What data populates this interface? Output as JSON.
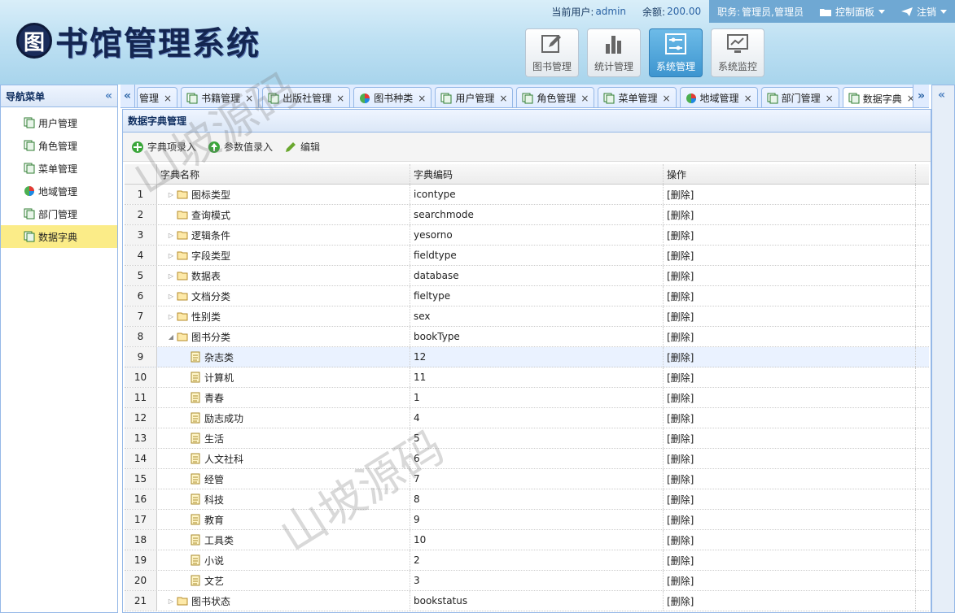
{
  "header": {
    "logo_mark": "图",
    "logo_text": "书馆管理系统",
    "current_user_label": "当前用户:",
    "current_user": "admin",
    "balance_label": "余额:",
    "balance": "200.00",
    "role_label": "职务:",
    "role": "管理员,管理员",
    "control_panel": "控制面板",
    "logout": "注销"
  },
  "modules": [
    {
      "label": "图书管理",
      "icon": "edit-icon",
      "active": false
    },
    {
      "label": "统计管理",
      "icon": "bar-chart-icon",
      "active": false
    },
    {
      "label": "系统管理",
      "icon": "settings-sliders-icon",
      "active": true
    },
    {
      "label": "系统监控",
      "icon": "monitor-icon",
      "active": false
    }
  ],
  "nav": {
    "title": "导航菜单",
    "items": [
      {
        "label": "用户管理",
        "icon": "page-icon"
      },
      {
        "label": "角色管理",
        "icon": "page-icon"
      },
      {
        "label": "菜单管理",
        "icon": "page-icon"
      },
      {
        "label": "地域管理",
        "icon": "globe-icon"
      },
      {
        "label": "部门管理",
        "icon": "page-icon"
      },
      {
        "label": "数据字典",
        "icon": "page-icon",
        "selected": true
      }
    ]
  },
  "tabs": [
    {
      "label": "管理",
      "icon": "",
      "active": false
    },
    {
      "label": "书籍管理",
      "icon": "page-icon",
      "active": false
    },
    {
      "label": "出版社管理",
      "icon": "page-icon",
      "active": false
    },
    {
      "label": "图书种类",
      "icon": "globe-icon",
      "active": false
    },
    {
      "label": "用户管理",
      "icon": "page-icon",
      "active": false
    },
    {
      "label": "角色管理",
      "icon": "page-icon",
      "active": false
    },
    {
      "label": "菜单管理",
      "icon": "page-icon",
      "active": false
    },
    {
      "label": "地域管理",
      "icon": "globe-icon",
      "active": false
    },
    {
      "label": "部门管理",
      "icon": "page-icon",
      "active": false
    },
    {
      "label": "数据字典",
      "icon": "page-icon",
      "active": true
    }
  ],
  "main": {
    "title": "数据字典管理",
    "toolbar": {
      "add_item": "字典项录入",
      "add_param": "参数值录入",
      "edit": "编辑"
    },
    "columns": {
      "name": "字典名称",
      "code": "字典编码",
      "op": "操作"
    },
    "rows": [
      {
        "num": "1",
        "name": "图标类型",
        "code": "icontype",
        "op": "[删除]",
        "level": 0,
        "expander": "collapsed"
      },
      {
        "num": "2",
        "name": "查询模式",
        "code": "searchmode",
        "op": "[删除]",
        "level": 0,
        "expander": "none"
      },
      {
        "num": "3",
        "name": "逻辑条件",
        "code": "yesorno",
        "op": "[删除]",
        "level": 0,
        "expander": "collapsed"
      },
      {
        "num": "4",
        "name": "字段类型",
        "code": "fieldtype",
        "op": "[删除]",
        "level": 0,
        "expander": "collapsed"
      },
      {
        "num": "5",
        "name": "数据表",
        "code": "database",
        "op": "[删除]",
        "level": 0,
        "expander": "collapsed"
      },
      {
        "num": "6",
        "name": "文档分类",
        "code": "fieltype",
        "op": "[删除]",
        "level": 0,
        "expander": "collapsed"
      },
      {
        "num": "7",
        "name": "性别类",
        "code": "sex",
        "op": "[删除]",
        "level": 0,
        "expander": "collapsed"
      },
      {
        "num": "8",
        "name": "图书分类",
        "code": "bookType",
        "op": "[删除]",
        "level": 0,
        "expander": "expanded"
      },
      {
        "num": "9",
        "name": "杂志类",
        "code": "12",
        "op": "[删除]",
        "level": 1,
        "highlight": true
      },
      {
        "num": "10",
        "name": "计算机",
        "code": "11",
        "op": "[删除]",
        "level": 1
      },
      {
        "num": "11",
        "name": "青春",
        "code": "1",
        "op": "[删除]",
        "level": 1
      },
      {
        "num": "12",
        "name": "励志成功",
        "code": "4",
        "op": "[删除]",
        "level": 1
      },
      {
        "num": "13",
        "name": "生活",
        "code": "5",
        "op": "[删除]",
        "level": 1
      },
      {
        "num": "14",
        "name": "人文社科",
        "code": "6",
        "op": "[删除]",
        "level": 1
      },
      {
        "num": "15",
        "name": "经管",
        "code": "7",
        "op": "[删除]",
        "level": 1
      },
      {
        "num": "16",
        "name": "科技",
        "code": "8",
        "op": "[删除]",
        "level": 1
      },
      {
        "num": "17",
        "name": "教育",
        "code": "9",
        "op": "[删除]",
        "level": 1
      },
      {
        "num": "18",
        "name": "工具类",
        "code": "10",
        "op": "[删除]",
        "level": 1
      },
      {
        "num": "19",
        "name": "小说",
        "code": "2",
        "op": "[删除]",
        "level": 1
      },
      {
        "num": "20",
        "name": "文艺",
        "code": "3",
        "op": "[删除]",
        "level": 1
      },
      {
        "num": "21",
        "name": "图书状态",
        "code": "bookstatus",
        "op": "[删除]",
        "level": 0,
        "expander": "collapsed"
      }
    ]
  },
  "watermark": "山坡源码"
}
